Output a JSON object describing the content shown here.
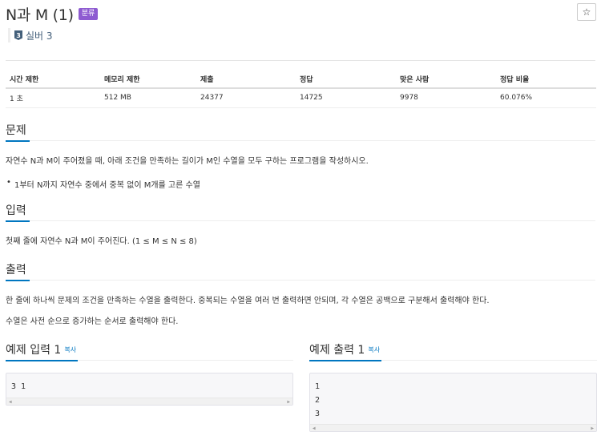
{
  "problem": {
    "title": "N과 M (1)",
    "badge": "분류",
    "tier": {
      "icon_text": "3",
      "label": "실버 3"
    },
    "star_icon": "☆"
  },
  "info_table": {
    "headers": [
      "시간 제한",
      "메모리 제한",
      "제출",
      "정답",
      "맞은 사람",
      "정답 비율"
    ],
    "values": [
      "1 초",
      "512 MB",
      "24377",
      "14725",
      "9978",
      "60.076%"
    ]
  },
  "sections": {
    "description": {
      "heading": "문제",
      "text": "자연수 N과 M이 주어졌을 때, 아래 조건을 만족하는 길이가 M인 수열을 모두 구하는 프로그램을 작성하시오.",
      "bullets": [
        "1부터 N까지 자연수 중에서 중복 없이 M개를 고른 수열"
      ]
    },
    "input": {
      "heading": "입력",
      "text": "첫째 줄에 자연수 N과 M이 주어진다. (1 ≤ M ≤ N ≤ 8)"
    },
    "output": {
      "heading": "출력",
      "text1": "한 줄에 하나씩 문제의 조건을 만족하는 수열을 출력한다. 중복되는 수열을 여러 번 출력하면 안되며, 각 수열은 공백으로 구분해서 출력해야 한다.",
      "text2": "수열은 사전 순으로 증가하는 순서로 출력해야 한다."
    }
  },
  "examples": {
    "input": {
      "heading": "예제 입력 1",
      "copy": "복사",
      "lines": [
        "3 1"
      ]
    },
    "output": {
      "heading": "예제 출력 1",
      "copy": "복사",
      "lines": [
        "1",
        "2",
        "3"
      ]
    }
  },
  "colors": {
    "accent": "#0076c0",
    "badge": "#8e5bd1",
    "tier": "#435f7a"
  }
}
